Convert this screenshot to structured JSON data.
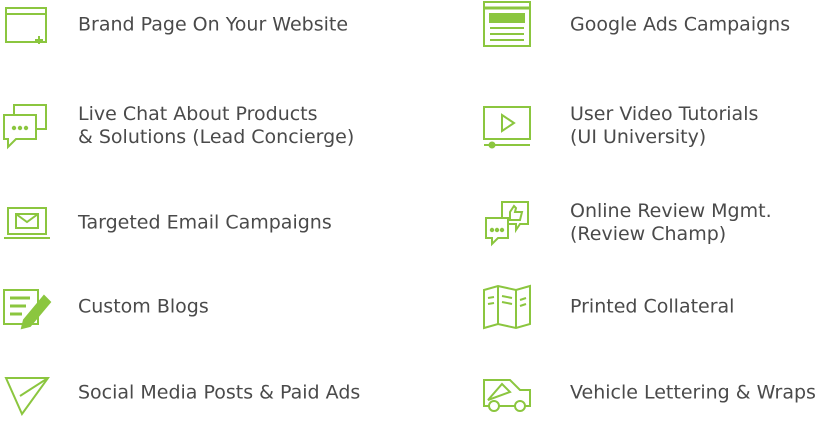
{
  "accent_color": "#8bc63f",
  "left_items": [
    {
      "icon": "browser-window-plus-icon",
      "label": "Brand Page On Your Website"
    },
    {
      "icon": "chat-bubbles-icon",
      "label": "Live Chat About Products\n& Solutions (Lead Concierge)"
    },
    {
      "icon": "laptop-email-icon",
      "label": "Targeted Email Campaigns"
    },
    {
      "icon": "document-edit-icon",
      "label": "Custom Blogs"
    },
    {
      "icon": "paper-plane-icon",
      "label": "Social Media Posts & Paid Ads"
    }
  ],
  "right_items": [
    {
      "icon": "document-stack-icon",
      "label": "Google Ads Campaigns"
    },
    {
      "icon": "video-player-icon",
      "label": "User Video Tutorials\n(UI University)"
    },
    {
      "icon": "review-thumbs-up-icon",
      "label": "Online Review Mgmt.\n(Review Champ)"
    },
    {
      "icon": "brochure-icon",
      "label": "Printed Collateral"
    },
    {
      "icon": "vehicle-van-icon",
      "label": "Vehicle Lettering & Wraps"
    }
  ]
}
